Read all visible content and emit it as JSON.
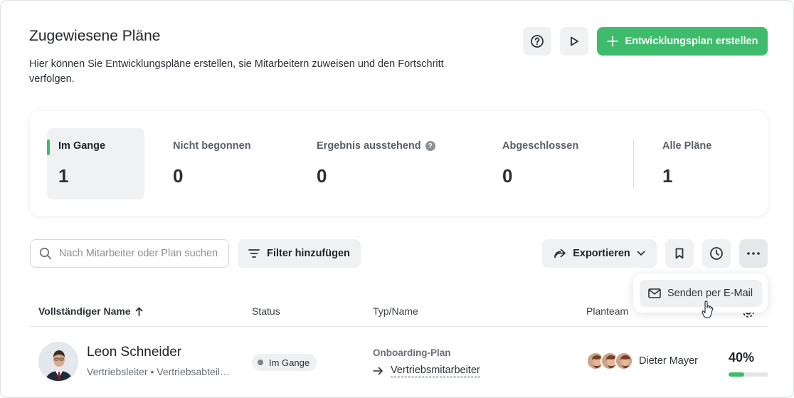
{
  "header": {
    "title": "Zugewiesene Pläne",
    "description": "Hier können Sie Entwicklungspläne erstellen, sie Mitarbeitern zuweisen und den Fortschritt verfolgen.",
    "help_icon": "question-circle-icon",
    "play_icon": "play-icon",
    "create_label": "Entwicklungsplan erstellen",
    "accent_color": "#3ebc6b"
  },
  "stats": [
    {
      "label": "Im Gange",
      "value": "1",
      "active": true
    },
    {
      "label": "Nicht begonnen",
      "value": "0"
    },
    {
      "label": "Ergebnis ausstehend",
      "value": "0",
      "has_help": true
    },
    {
      "label": "Abgeschlossen",
      "value": "0"
    },
    {
      "label": "Alle Pläne",
      "value": "1"
    }
  ],
  "toolbar": {
    "search_placeholder": "Nach Mitarbeiter oder Plan suchen",
    "filter_label": "Filter hinzufügen",
    "export_label": "Exportieren"
  },
  "menu": {
    "send_email_label": "Senden per E-Mail"
  },
  "table": {
    "columns": [
      "Vollständiger Name",
      "Status",
      "Typ/Name",
      "Planteam"
    ],
    "rows": [
      {
        "name": "Leon Schneider",
        "role": "Vertriebsleiter • Vertriebsabteilung",
        "status": "Im Gange",
        "type_label": "Onboarding-Plan",
        "type_name": "Vertriebsmitarbeiter",
        "team_name": "Dieter Mayer",
        "progress_text": "40%",
        "progress": 0.4
      }
    ]
  }
}
